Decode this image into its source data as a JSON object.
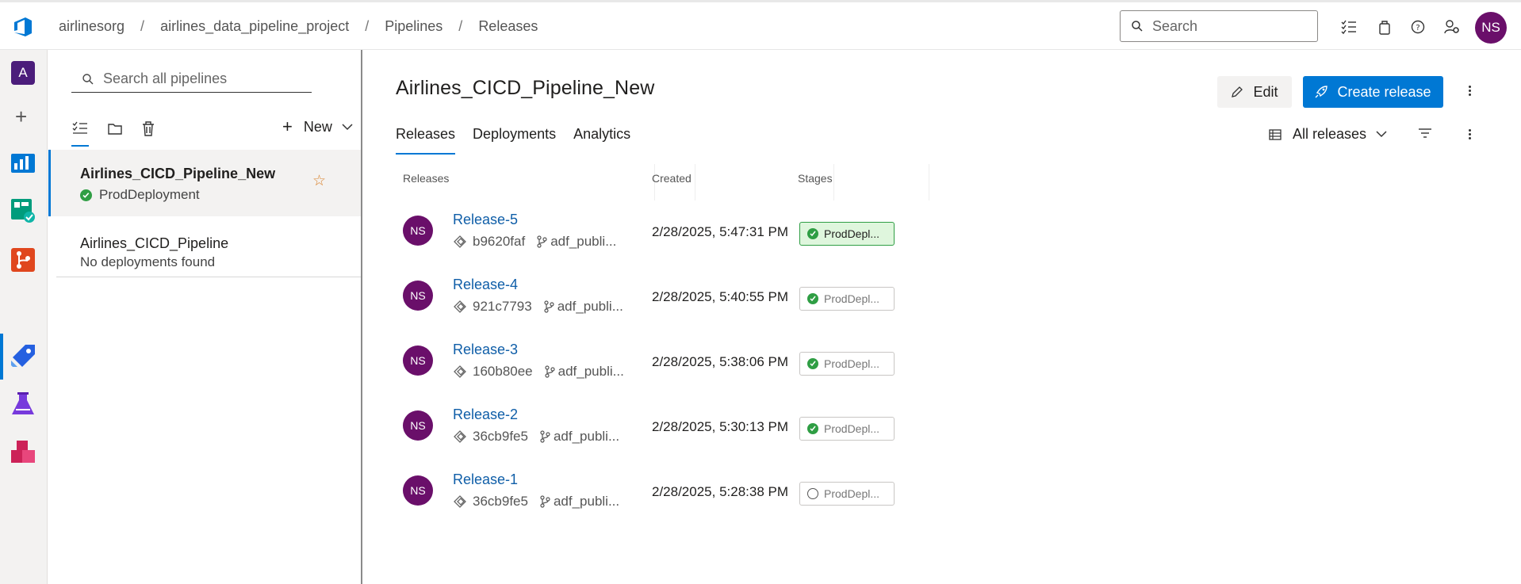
{
  "breadcrumb": {
    "org": "airlinesorg",
    "project": "airlines_data_pipeline_project",
    "section": "Pipelines",
    "page": "Releases",
    "separator": "/"
  },
  "topbar": {
    "search_placeholder": "Search",
    "user_initials": "NS"
  },
  "rail": {
    "org_initial": "A",
    "icons": [
      "overview-icon",
      "boards-icon",
      "repos-icon",
      "pipelines-icon",
      "test-plans-icon",
      "artifacts-icon"
    ]
  },
  "panel": {
    "search_placeholder": "Search all pipelines",
    "new_label": "New",
    "pipelines": [
      {
        "name": "Airlines_CICD_Pipeline_New",
        "status": "ProdDeployment"
      },
      {
        "name": "Airlines_CICD_Pipeline",
        "status": "No deployments found"
      }
    ]
  },
  "main": {
    "title": "Airlines_CICD_Pipeline_New",
    "edit_label": "Edit",
    "create_label": "Create release",
    "tabs": [
      "Releases",
      "Deployments",
      "Analytics"
    ],
    "filter_label": "All releases",
    "columns": {
      "releases": "Releases",
      "created": "Created",
      "stages": "Stages"
    },
    "releases": [
      {
        "avatar": "NS",
        "name": "Release-5",
        "commit": "b9620faf",
        "branch": "adf_publi...",
        "created": "2/28/2025, 5:47:31 PM",
        "stage": "ProdDepl...",
        "stage_status": "succeeded",
        "highlighted": true
      },
      {
        "avatar": "NS",
        "name": "Release-4",
        "commit": "921c7793",
        "branch": "adf_publi...",
        "created": "2/28/2025, 5:40:55 PM",
        "stage": "ProdDepl...",
        "stage_status": "succeeded",
        "highlighted": false
      },
      {
        "avatar": "NS",
        "name": "Release-3",
        "commit": "160b80ee",
        "branch": "adf_publi...",
        "created": "2/28/2025, 5:38:06 PM",
        "stage": "ProdDepl...",
        "stage_status": "succeeded",
        "highlighted": false
      },
      {
        "avatar": "NS",
        "name": "Release-2",
        "commit": "36cb9fe5",
        "branch": "adf_publi...",
        "created": "2/28/2025, 5:30:13 PM",
        "stage": "ProdDepl...",
        "stage_status": "succeeded",
        "highlighted": false
      },
      {
        "avatar": "NS",
        "name": "Release-1",
        "commit": "36cb9fe5",
        "branch": "adf_publi...",
        "created": "2/28/2025, 5:28:38 PM",
        "stage": "ProdDepl...",
        "stage_status": "not-deployed",
        "highlighted": false
      }
    ]
  },
  "colors": {
    "accent": "#0078d4",
    "avatar": "#6a0f6a",
    "success": "#2f9e44",
    "highlight_bg": "#dff6dd",
    "link": "#0f5ea8"
  }
}
